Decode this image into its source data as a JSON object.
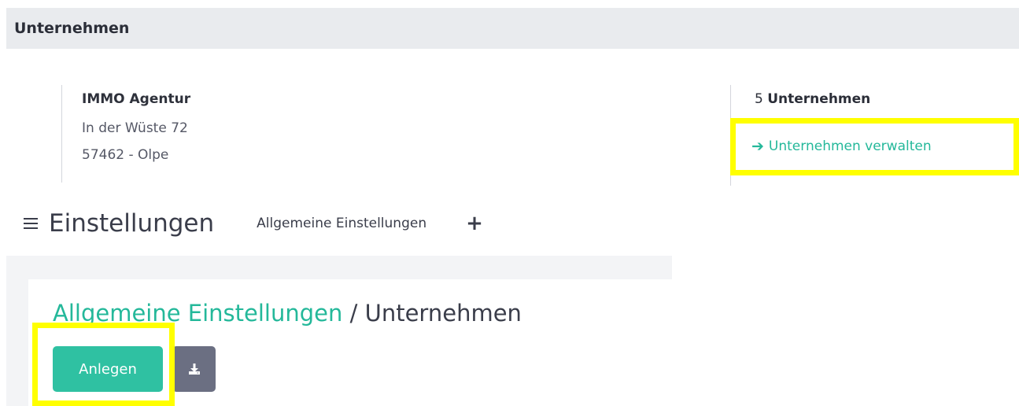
{
  "section": {
    "title": "Unternehmen"
  },
  "company": {
    "name": "IMMO Agentur",
    "street": "In der Wüste 72",
    "city": "57462 - Olpe"
  },
  "summary": {
    "count": "5",
    "count_label": "Unternehmen",
    "manage_link": "Unternehmen verwalten"
  },
  "settings": {
    "title": "Einstellungen",
    "tab_general": "Allgemeine Einstellungen",
    "add_icon": "plus-icon",
    "menu_icon": "hamburger-icon"
  },
  "breadcrumb": {
    "parent": "Allgemeine Einstellungen",
    "separator": " / ",
    "current": "Unternehmen"
  },
  "actions": {
    "create_label": "Anlegen",
    "download_icon": "download-icon"
  },
  "colors": {
    "accent": "#24b89a",
    "primary_button": "#2fc1a2",
    "secondary_button": "#6b6f82",
    "highlight": "#ffff00",
    "header_bg": "#e9ebee"
  }
}
